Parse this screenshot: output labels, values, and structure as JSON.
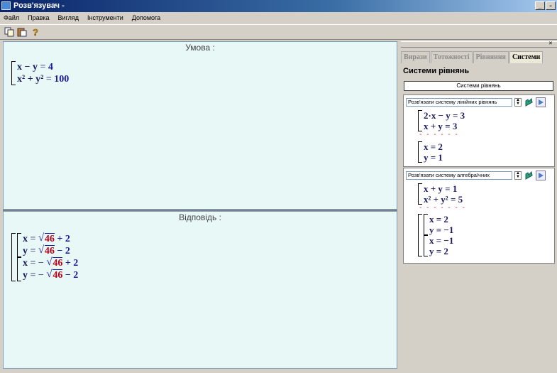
{
  "window": {
    "title": "Розв'язувач -",
    "minimize": "_",
    "maximize": "▫"
  },
  "menu": [
    "Файл",
    "Правка",
    "Вигляд",
    "Інструменти",
    "Допомога"
  ],
  "condition": {
    "title": "Умова :",
    "equations": [
      {
        "lhs": "x − y",
        "rhs": "4"
      },
      {
        "lhs": "x² + y²",
        "rhs": "100"
      }
    ]
  },
  "answer": {
    "title": "Відповідь :",
    "solutions": [
      {
        "var": "x",
        "sign": "",
        "rad": "46",
        "rest": "+ 2"
      },
      {
        "var": "y",
        "sign": "",
        "rad": "46",
        "rest": "− 2"
      },
      {
        "var": "x",
        "sign": "−",
        "rad": "46",
        "rest": "+ 2"
      },
      {
        "var": "y",
        "sign": "−",
        "rad": "46",
        "rest": "− 2"
      }
    ]
  },
  "sidebar": {
    "tabs": [
      {
        "label": "Вирази",
        "active": false
      },
      {
        "label": "Тотожності",
        "active": false
      },
      {
        "label": "Рівняння",
        "active": false
      },
      {
        "label": "Системи",
        "active": true
      }
    ],
    "heading": "Системи рівнянь",
    "button": "Системи рівнянь",
    "card1": {
      "select": "Розв'язати систему лінійних рівнянь",
      "system": [
        "2·x − y = 3",
        "x + y = 3"
      ],
      "dashes": "- - - - - -",
      "result": [
        "x = 2",
        "y = 1"
      ]
    },
    "card2": {
      "select": "Розв'язати систему алгебраїчних",
      "system": [
        "x + y = 1",
        "x² + y² = 5"
      ],
      "dashes": "- - - - - - -",
      "result": [
        [
          "x = 2",
          "y = −1"
        ],
        [
          "x = −1",
          "y = 2"
        ]
      ]
    }
  },
  "colors": {
    "pane": "#e7f8f6",
    "accent": "#1a1aa0",
    "radicand": "#c0001a"
  }
}
